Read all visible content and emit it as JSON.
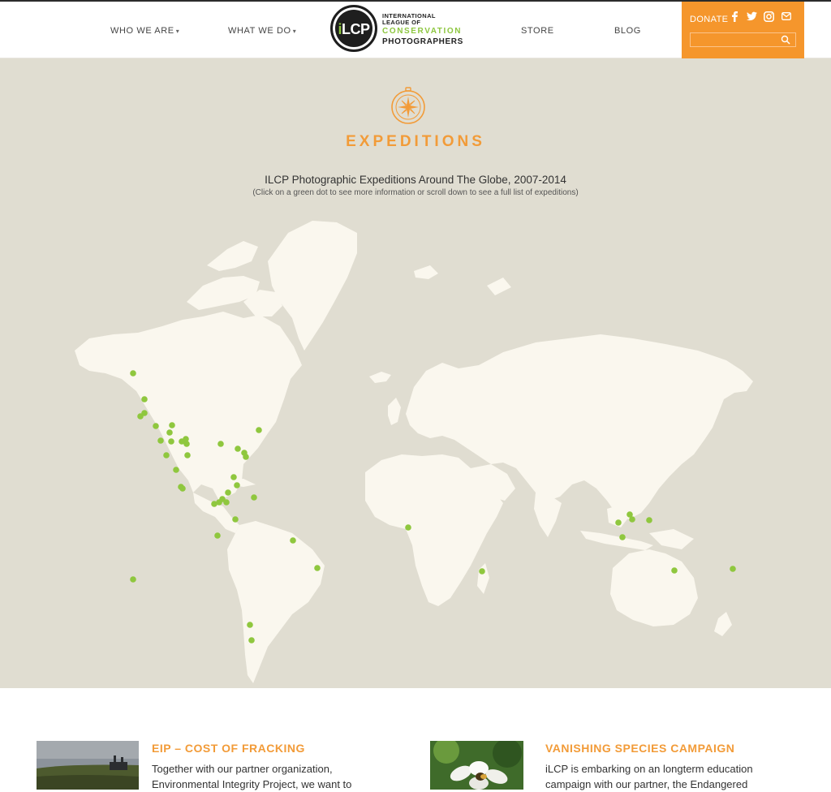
{
  "nav": {
    "who_we_are": "WHO WE ARE",
    "what_we_do": "WHAT WE DO",
    "store": "STORE",
    "blog": "BLOG",
    "caret": "▾"
  },
  "logo": {
    "mark_i": "i",
    "mark_lcp": "LCP",
    "line1": "INTERNATIONAL LEAGUE OF",
    "line2": "CONSERVATION",
    "line3": "PHOTOGRAPHERS"
  },
  "donate": {
    "label": "DONATE",
    "icons": [
      "facebook-icon",
      "twitter-icon",
      "instagram-icon",
      "mail-icon"
    ],
    "search_value": ""
  },
  "map_section": {
    "title": "EXPEDITIONS",
    "heading": "ILCP Photographic Expeditions Around The Globe, 2007-2014",
    "subheading": "(Click on a green dot to see more information or scroll down to see a full list of expeditions)"
  },
  "cards": [
    {
      "title": "EIP – COST OF FRACKING",
      "text": "Together with our partner organization, Environmental Integrity Project, we want to"
    },
    {
      "title": "VANISHING SPECIES CAMPAIGN",
      "text": "iLCP is embarking on an longterm education campaign with our partner, the Endangered"
    }
  ],
  "colors": {
    "accent_orange": "#f5962c",
    "title_orange": "#f29b38",
    "dot_green": "#8fc73e",
    "map_bg": "#e0ddd1",
    "land": "#faf7ee"
  }
}
